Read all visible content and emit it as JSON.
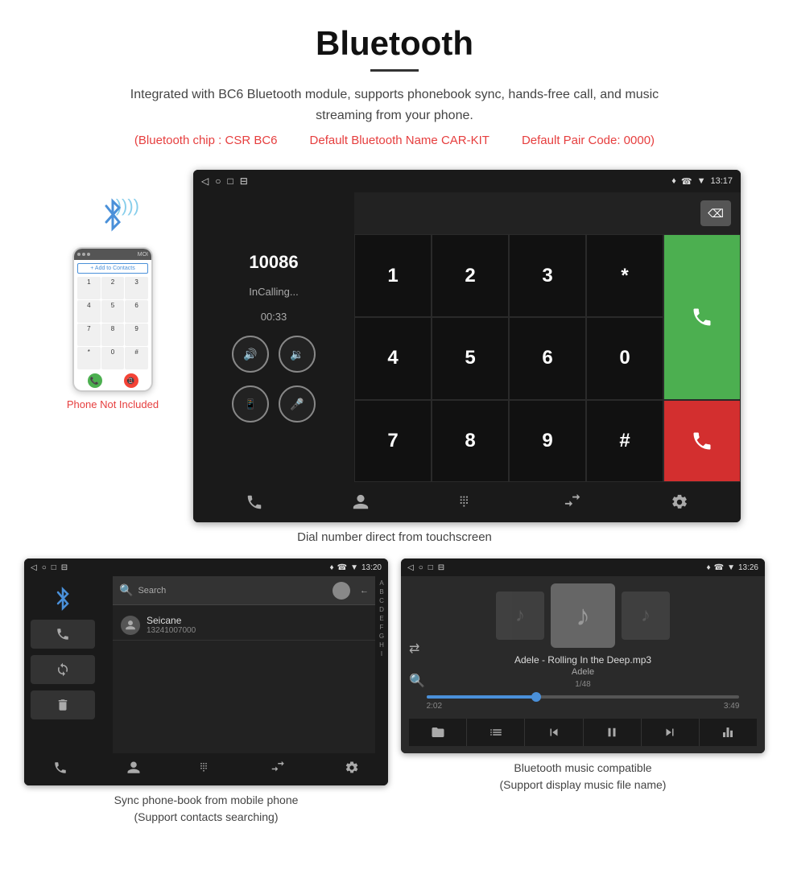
{
  "header": {
    "title": "Bluetooth",
    "description": "Integrated with BC6 Bluetooth module, supports phonebook sync, hands-free call, and music streaming from your phone.",
    "spec1": "(Bluetooth chip : CSR BC6",
    "spec2": "Default Bluetooth Name CAR-KIT",
    "spec3": "Default Pair Code: 0000)"
  },
  "main_screen": {
    "status_bar": {
      "nav_icons": [
        "◁",
        "○",
        "□",
        "⊟"
      ],
      "right_icons": [
        "♦",
        "☎",
        "▼",
        "13:17"
      ]
    },
    "call": {
      "number": "10086",
      "status": "InCalling...",
      "timer": "00:33"
    },
    "dialpad_keys": [
      "1",
      "2",
      "3",
      "*",
      "4",
      "5",
      "6",
      "0",
      "7",
      "8",
      "9",
      "#"
    ]
  },
  "phone_mock": {
    "add_contacts": "+ Add to Contacts",
    "keys": [
      "1",
      "2",
      "3",
      "4",
      "5",
      "6",
      "7",
      "8",
      "9",
      "*",
      "0",
      "#"
    ]
  },
  "phone_not_included": "Phone Not Included",
  "main_caption": "Dial number direct from touchscreen",
  "phonebook_screen": {
    "status_time": "13:20",
    "contact_name": "Seicane",
    "contact_number": "13241007000",
    "alpha_letters": [
      "A",
      "B",
      "C",
      "D",
      "E",
      "F",
      "G",
      "H",
      "I"
    ]
  },
  "phonebook_caption_line1": "Sync phone-book from mobile phone",
  "phonebook_caption_line2": "(Support contacts searching)",
  "music_screen": {
    "status_time": "13:26",
    "song_title": "Adele - Rolling In the Deep.mp3",
    "artist": "Adele",
    "track_info": "1/48",
    "time_current": "2:02",
    "time_total": "3:49"
  },
  "music_caption_line1": "Bluetooth music compatible",
  "music_caption_line2": "(Support display music file name)"
}
